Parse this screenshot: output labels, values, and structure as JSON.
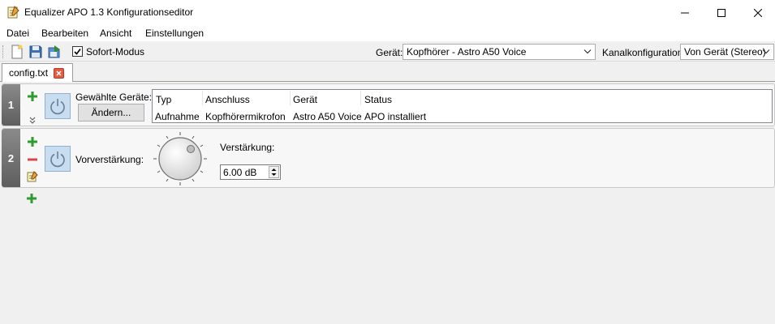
{
  "window": {
    "title": "Equalizer APO 1.3 Konfigurationseditor",
    "icon": "notepad-icon"
  },
  "menu": [
    "Datei",
    "Bearbeiten",
    "Ansicht",
    "Einstellungen"
  ],
  "toolbar": {
    "icons": [
      "new-file-icon",
      "save-icon",
      "open-icon"
    ],
    "instant_mode_label": "Sofort-Modus",
    "instant_mode_checked": true,
    "device_label": "Gerät:",
    "device_value": "Kopfhörer - Astro A50 Voice",
    "channel_label": "Kanalkonfiguration:",
    "channel_value": "Von Gerät (Stereo)"
  },
  "tabs": [
    {
      "label": "config.txt",
      "active": true
    }
  ],
  "filters": [
    {
      "number": "1",
      "selected_devices_label": "Gewählte Geräte:",
      "change_button": "Ändern...",
      "table": {
        "headers": [
          "Typ",
          "Anschluss",
          "Gerät",
          "Status"
        ],
        "rows": [
          [
            "Aufnahme",
            "Kopfhörermikrofon",
            "Astro A50 Voice",
            "APO installiert"
          ]
        ]
      }
    },
    {
      "number": "2",
      "preamp_label": "Vorverstärkung:",
      "gain_label": "Verstärkung:",
      "gain_value": "6.00 dB"
    }
  ],
  "colors": {
    "accent": "#c9ddf0",
    "add": "#2e9b2e",
    "remove": "#d84a4a",
    "tab_close": "#e25b43"
  }
}
